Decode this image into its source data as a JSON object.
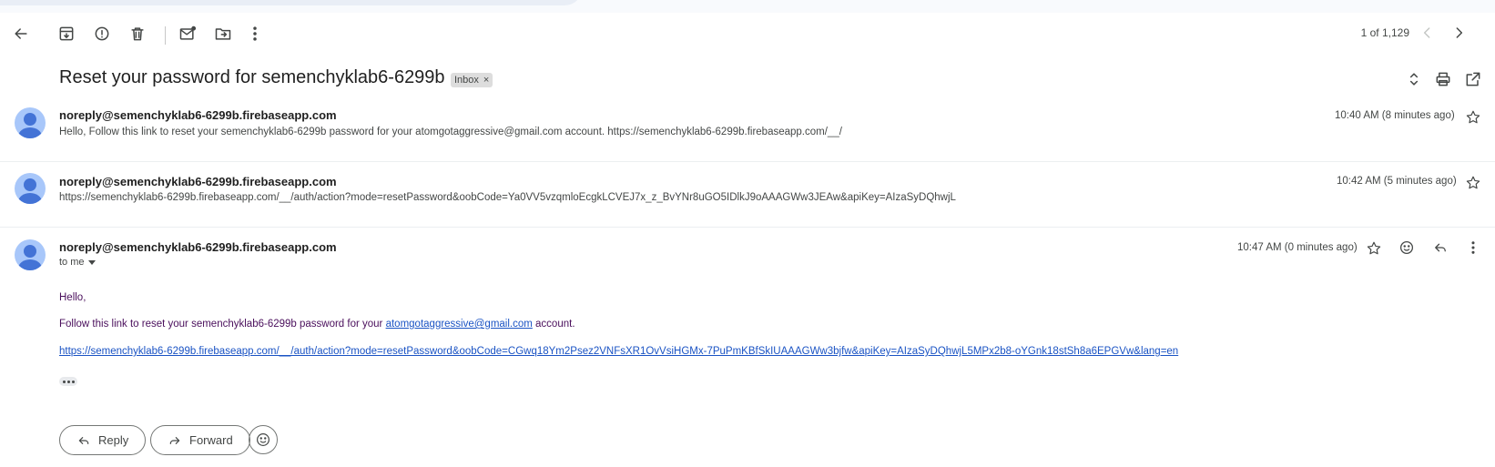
{
  "toolbar": {
    "back_icon": "arrow-back-icon",
    "archive_icon": "archive-icon",
    "spam_icon": "report-spam-icon",
    "delete_icon": "trash-icon",
    "mark_unread_icon": "mark-unread-icon",
    "move_icon": "move-to-folder-icon",
    "more_icon": "more-vert-icon",
    "pager_text": "1 of 1,129",
    "prev_icon": "chevron-left-icon",
    "next_icon": "chevron-right-icon"
  },
  "thread": {
    "subject": "Reset your password for semenchyklab6-6299b",
    "label_chip": "Inbox",
    "label_remove": "×",
    "expand_icon": "unfold-icon",
    "print_icon": "print-icon",
    "popout_icon": "open-in-new-icon"
  },
  "messages": [
    {
      "sender": "noreply@semenchyklab6-6299b.firebaseapp.com",
      "snippet": "Hello, Follow this link to reset your semenchyklab6-6299b password for your atomgotaggressive@gmail.com account. https://semenchyklab6-6299b.firebaseapp.com/__/",
      "time": "10:40 AM (8 minutes ago)"
    },
    {
      "sender": "noreply@semenchyklab6-6299b.firebaseapp.com",
      "snippet": "https://semenchyklab6-6299b.firebaseapp.com/__/auth/action?mode=resetPassword&oobCode=Ya0VV5vzqmloEcgkLCVEJ7x_z_BvYNr8uGO5IDlkJ9oAAAGWw3JEAw&apiKey=AIzaSyDQhwjL",
      "time": "10:42 AM (5 minutes ago)"
    },
    {
      "sender": "noreply@semenchyklab6-6299b.firebaseapp.com",
      "to_label": "to me",
      "time": "10:47 AM (0 minutes ago)",
      "greeting": "Hello,",
      "line_before": "Follow this link to reset your semenchyklab6-6299b password for your ",
      "email_link": "atomgotaggressive@gmail.com",
      "line_after": " account.",
      "reset_link": "https://semenchyklab6-6299b.firebaseapp.com/__/auth/action?mode=resetPassword&oobCode=CGwq18Ym2Psez2VNFsXR1OvVsiHGMx-7PuPmKBfSkIUAAAGWw3bjfw&apiKey=AIzaSyDQhwjL5MPx2b8-oYGnk18stSh8a6EPGVw&lang=en"
    }
  ],
  "actions": {
    "reply_label": "Reply",
    "forward_label": "Forward",
    "emoji_icon": "add-reaction-icon"
  },
  "colors": {
    "link": "#1a53c4",
    "body_text": "#4a0f5c",
    "avatar_bg": "#a8c7fa",
    "avatar_fg": "#4373d6"
  }
}
